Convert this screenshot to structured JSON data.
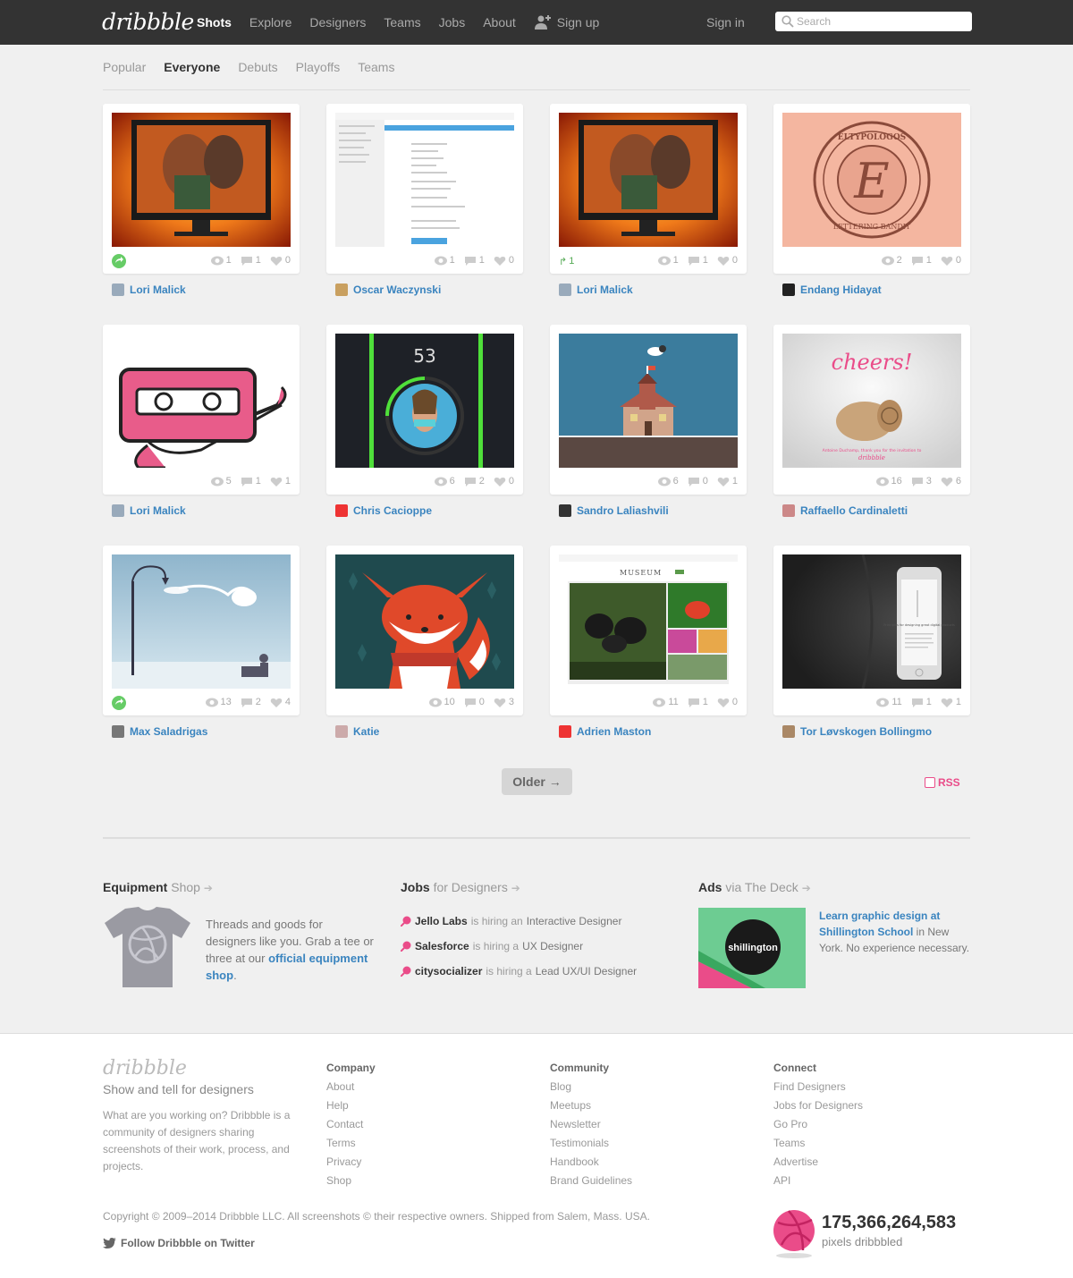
{
  "header": {
    "logo": "dribbble",
    "nav": [
      {
        "label": "Shots",
        "active": true
      },
      {
        "label": "Explore"
      },
      {
        "label": "Designers"
      },
      {
        "label": "Teams"
      },
      {
        "label": "Jobs"
      },
      {
        "label": "About"
      }
    ],
    "signup": "Sign up",
    "signin": "Sign in",
    "search_placeholder": "Search"
  },
  "subnav": [
    "Popular",
    "Everyone",
    "Debuts",
    "Playoffs",
    "Teams"
  ],
  "subnav_active": "Everyone",
  "shots": [
    {
      "player": "Lori Malick",
      "views": "1",
      "comments": "1",
      "likes": "0",
      "rebound": "icon"
    },
    {
      "player": "Oscar Waczynski",
      "views": "1",
      "comments": "1",
      "likes": "0"
    },
    {
      "player": "Lori Malick",
      "views": "1",
      "comments": "1",
      "likes": "0",
      "rebound_count": "1"
    },
    {
      "player": "Endang Hidayat",
      "views": "2",
      "comments": "1",
      "likes": "0"
    },
    {
      "player": "Lori Malick",
      "views": "5",
      "comments": "1",
      "likes": "1"
    },
    {
      "player": "Chris Cacioppe",
      "views": "6",
      "comments": "2",
      "likes": "0"
    },
    {
      "player": "Sandro Laliashvili",
      "views": "6",
      "comments": "0",
      "likes": "1"
    },
    {
      "player": "Raffaello Cardinaletti",
      "views": "16",
      "comments": "3",
      "likes": "6"
    },
    {
      "player": "Max Saladrigas",
      "views": "13",
      "comments": "2",
      "likes": "4",
      "rebound": "icon"
    },
    {
      "player": "Katie",
      "views": "10",
      "comments": "0",
      "likes": "3"
    },
    {
      "player": "Adrien Maston",
      "views": "11",
      "comments": "1",
      "likes": "0"
    },
    {
      "player": "Tor Løvskogen Bollingmo",
      "views": "11",
      "comments": "1",
      "likes": "1"
    }
  ],
  "shot_texts": {
    "clock": "53",
    "cheers": "cheers!",
    "cheers_caption": "Antoine Duchamp, thank you for the invitation to",
    "cheers_brand": "dribbble",
    "museum": "MUSEUM",
    "eltypologos": "ELTYPOLOGOS",
    "lettering_bandit": "LETTERING BANDIT",
    "principles": "Principles for designing great digital products"
  },
  "pagination": {
    "older": "Older →",
    "rss": "RSS"
  },
  "equipment": {
    "title": "Equipment",
    "title_suffix": "Shop",
    "text": "Threads and goods for designers like you. Grab a tee or three at our ",
    "link": "official equipment shop",
    "end": "."
  },
  "jobs": {
    "title": "Jobs",
    "title_suffix": "for Designers",
    "connector": "is hiring a",
    "connector_an": "is hiring an",
    "items": [
      {
        "company": "Jello Labs",
        "article": "an",
        "role": "Interactive Designer"
      },
      {
        "company": "Salesforce",
        "article": "a",
        "role": "UX Designer"
      },
      {
        "company": "citysocializer",
        "article": "a",
        "role": "Lead UX/UI Designer"
      }
    ]
  },
  "ads": {
    "title": "Ads",
    "title_suffix": "via The Deck",
    "link": "Learn graphic design at Shillington School",
    "text": " in New York. No experience necessary.",
    "badge": "shillington"
  },
  "footer": {
    "logo": "dribbble",
    "tagline": "Show and tell for designers",
    "description": "What are you working on? Dribbble is a community of designers sharing screenshots of their work, process, and projects.",
    "columns": [
      {
        "head": "Company",
        "items": [
          "About",
          "Help",
          "Contact",
          "Terms",
          "Privacy",
          "Shop"
        ]
      },
      {
        "head": "Community",
        "items": [
          "Blog",
          "Meetups",
          "Newsletter",
          "Testimonials",
          "Handbook",
          "Brand Guidelines"
        ]
      },
      {
        "head": "Connect",
        "items": [
          "Find Designers",
          "Jobs for Designers",
          "Go Pro",
          "Teams",
          "Advertise",
          "API"
        ]
      }
    ],
    "copyright": "Copyright © 2009–2014 Dribbble LLC. All screenshots © their respective owners. Shipped from Salem, Mass. USA.",
    "twitter": "Follow Dribbble on Twitter",
    "counter": "175,366,264,583",
    "counter_label": "pixels dribbbled"
  },
  "colors": {
    "brand_pink": "#ea4c89",
    "link_blue": "#3a84bf",
    "header_bg": "#333333"
  }
}
